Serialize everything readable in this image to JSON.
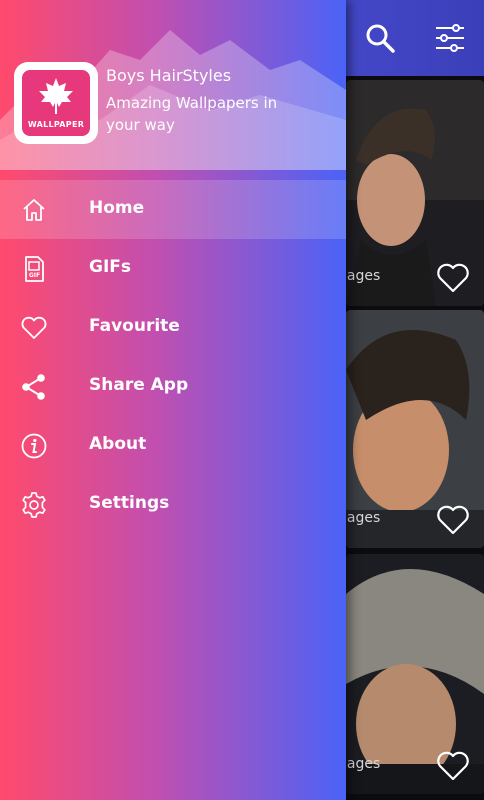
{
  "drawer": {
    "app_name": "Boys HairStyles",
    "tagline": "Amazing Wallpapers in your way",
    "logo_text": "WALLPAPER",
    "menu": [
      {
        "label": "Home",
        "icon": "home-icon",
        "active": true
      },
      {
        "label": "GIFs",
        "icon": "gif-file-icon",
        "active": false
      },
      {
        "label": "Favourite",
        "icon": "heart-outline-icon",
        "active": false
      },
      {
        "label": "Share App",
        "icon": "share-icon",
        "active": false
      },
      {
        "label": "About",
        "icon": "info-icon",
        "active": false
      },
      {
        "label": "Settings",
        "icon": "gear-icon",
        "active": false
      }
    ]
  },
  "background": {
    "cards": [
      {
        "caption": "nages"
      },
      {
        "caption": "nages"
      },
      {
        "caption": "nages"
      }
    ]
  },
  "colors": {
    "drawer_gradient_start": "#ff4a6c",
    "drawer_gradient_end": "#4a63f7",
    "appbar": "#5a5ef2"
  }
}
